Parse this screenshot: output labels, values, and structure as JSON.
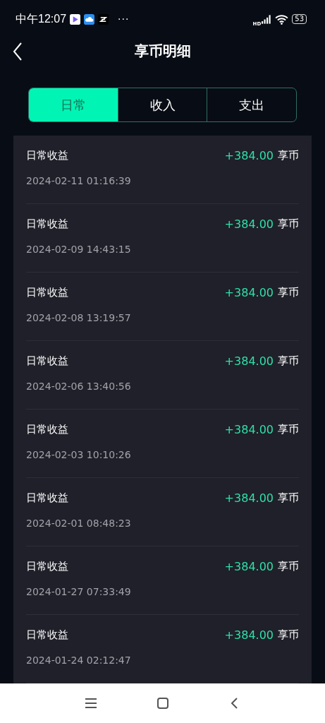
{
  "status_bar": {
    "time": "中午12:07",
    "more": "···",
    "network": "HD",
    "battery": "53"
  },
  "header": {
    "title": "享币明细"
  },
  "tabs": [
    {
      "label": "日常",
      "selected": true
    },
    {
      "label": "收入",
      "selected": false
    },
    {
      "label": "支出",
      "selected": false
    }
  ],
  "records": [
    {
      "title": "日常收益",
      "amount": "+384.00",
      "unit": "享币",
      "time": "2024-02-11 01:16:39"
    },
    {
      "title": "日常收益",
      "amount": "+384.00",
      "unit": "享币",
      "time": "2024-02-09 14:43:15"
    },
    {
      "title": "日常收益",
      "amount": "+384.00",
      "unit": "享币",
      "time": "2024-02-08 13:19:57"
    },
    {
      "title": "日常收益",
      "amount": "+384.00",
      "unit": "享币",
      "time": "2024-02-06 13:40:56"
    },
    {
      "title": "日常收益",
      "amount": "+384.00",
      "unit": "享币",
      "time": "2024-02-03 10:10:26"
    },
    {
      "title": "日常收益",
      "amount": "+384.00",
      "unit": "享币",
      "time": "2024-02-01 08:48:23"
    },
    {
      "title": "日常收益",
      "amount": "+384.00",
      "unit": "享币",
      "time": "2024-01-27 07:33:49"
    },
    {
      "title": "日常收益",
      "amount": "+384.00",
      "unit": "享币",
      "time": "2024-01-24 02:12:47"
    }
  ]
}
